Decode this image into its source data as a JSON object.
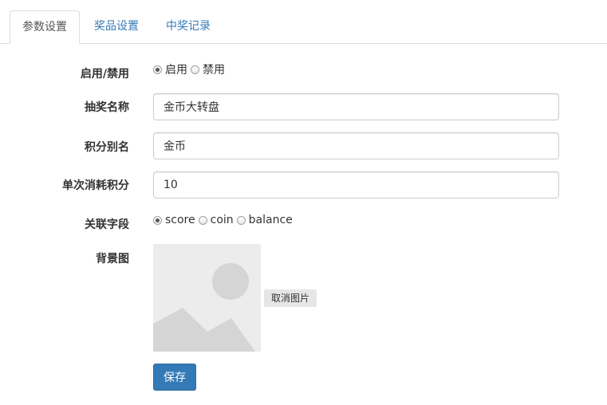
{
  "tabs": [
    {
      "label": "参数设置",
      "active": true
    },
    {
      "label": "奖品设置",
      "active": false
    },
    {
      "label": "中奖记录",
      "active": false
    }
  ],
  "form": {
    "status": {
      "label": "启用/禁用",
      "options": [
        {
          "label": "启用",
          "checked": true
        },
        {
          "label": "禁用",
          "checked": false
        }
      ]
    },
    "name": {
      "label": "抽奖名称",
      "value": "金币大转盘"
    },
    "points_alias": {
      "label": "积分别名",
      "value": "金币"
    },
    "cost_per_draw": {
      "label": "单次消耗积分",
      "value": "10"
    },
    "related_field": {
      "label": "关联字段",
      "options": [
        {
          "label": "score",
          "checked": true
        },
        {
          "label": "coin",
          "checked": false
        },
        {
          "label": "balance",
          "checked": false
        }
      ]
    },
    "background_image": {
      "label": "背景图",
      "cancel_label": "取消图片"
    },
    "save_label": "保存"
  },
  "colors": {
    "primary": "#337ab7",
    "tab_link": "#337ab7",
    "placeholder_bg": "#ececec",
    "placeholder_shape": "#d5d5d5"
  }
}
